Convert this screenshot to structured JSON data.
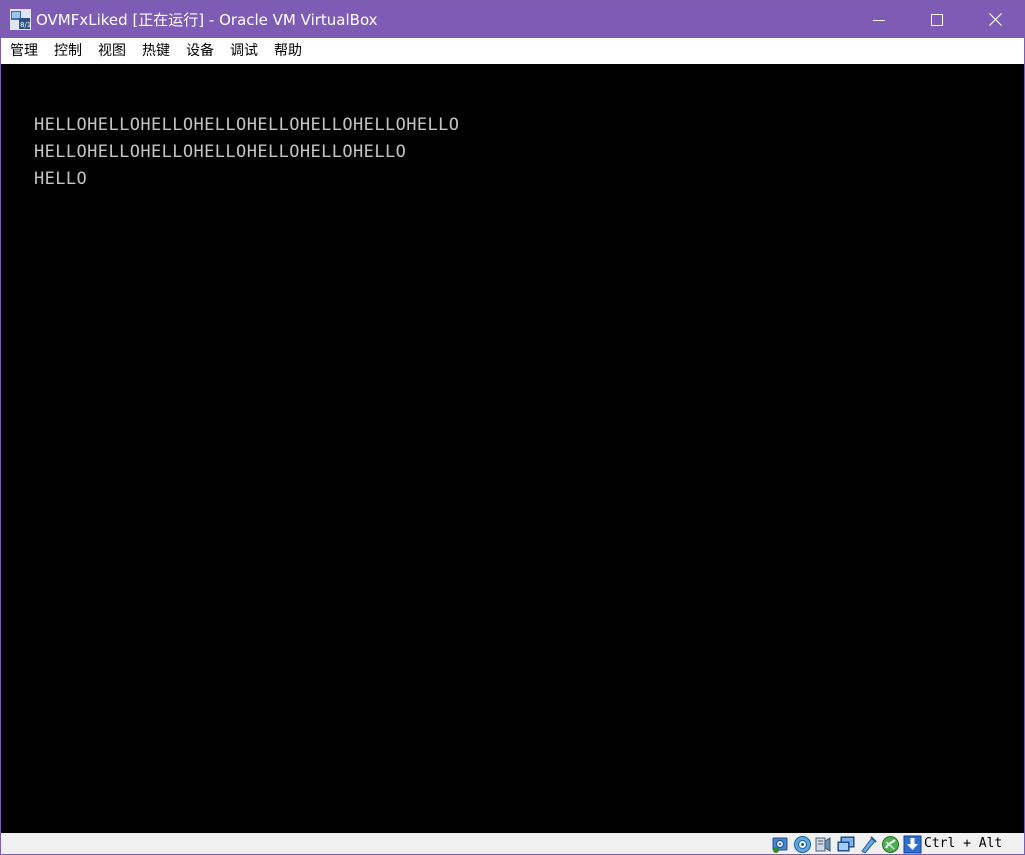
{
  "window": {
    "title": "OVMFxLiked [正在运行] - Oracle VM VirtualBox",
    "titlebar_color": "#7e5bb5"
  },
  "menu": {
    "items": [
      {
        "label": "管理"
      },
      {
        "label": "控制"
      },
      {
        "label": "视图"
      },
      {
        "label": "热键"
      },
      {
        "label": "设备"
      },
      {
        "label": "调试"
      },
      {
        "label": "帮助"
      }
    ]
  },
  "console": {
    "lines": [
      "HELLOHELLOHELLOHELLOHELLOHELLOHELLOHELLO",
      "HELLOHELLOHELLOHELLOHELLOHELLOHELLO",
      "HELLO"
    ],
    "text_color": "#c4c4c4",
    "background": "#000000"
  },
  "statusbar": {
    "icons": [
      "hard-disk-icon",
      "optical-drive-icon",
      "audio-icon",
      "network-icon",
      "usb-icon",
      "shared-folders-icon",
      "mouse-integration-icon"
    ],
    "host_key": "Ctrl + Alt"
  }
}
